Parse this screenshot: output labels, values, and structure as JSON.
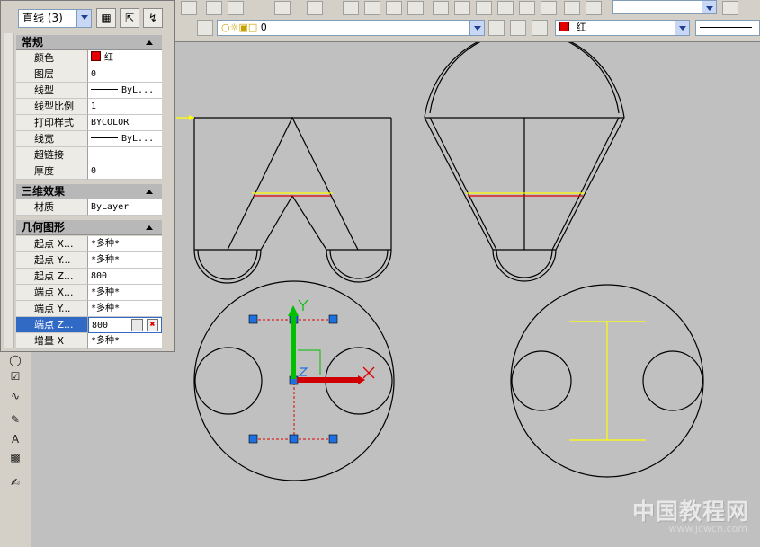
{
  "palette": {
    "object_type": "直线 (3)",
    "sections": [
      {
        "title": "常规"
      },
      {
        "title": "三维效果"
      },
      {
        "title": "几何图形"
      }
    ],
    "general": [
      {
        "key": "颜色",
        "value": "红"
      },
      {
        "key": "图层",
        "value": "0"
      },
      {
        "key": "线型",
        "value": "ByL..."
      },
      {
        "key": "线型比例",
        "value": "1"
      },
      {
        "key": "打印样式",
        "value": "BYCOLOR"
      },
      {
        "key": "线宽",
        "value": "ByL..."
      },
      {
        "key": "超链接",
        "value": ""
      },
      {
        "key": "厚度",
        "value": "0"
      }
    ],
    "effects3d": [
      {
        "key": "材质",
        "value": "ByLayer"
      }
    ],
    "geometry": [
      {
        "key": "起点 X...",
        "value": "*多种*"
      },
      {
        "key": "起点 Y...",
        "value": "*多种*"
      },
      {
        "key": "起点 Z...",
        "value": "800"
      },
      {
        "key": "端点 X...",
        "value": "*多种*"
      },
      {
        "key": "端点 Y...",
        "value": "*多种*"
      },
      {
        "key": "端点 Z...",
        "value": "800"
      },
      {
        "key": "增量 X",
        "value": "*多种*"
      }
    ]
  },
  "toolbar": {
    "layer_value": "0",
    "color_value": "红"
  },
  "colors": {
    "selected_line": "#e00000",
    "yellow_line": "#ffff00",
    "grip": "#1e6fe0",
    "ucs_y": "#00c000",
    "ucs_x": "#e00000"
  },
  "watermark": {
    "text": "中国教程网",
    "url": "www.jcwcn.com"
  }
}
